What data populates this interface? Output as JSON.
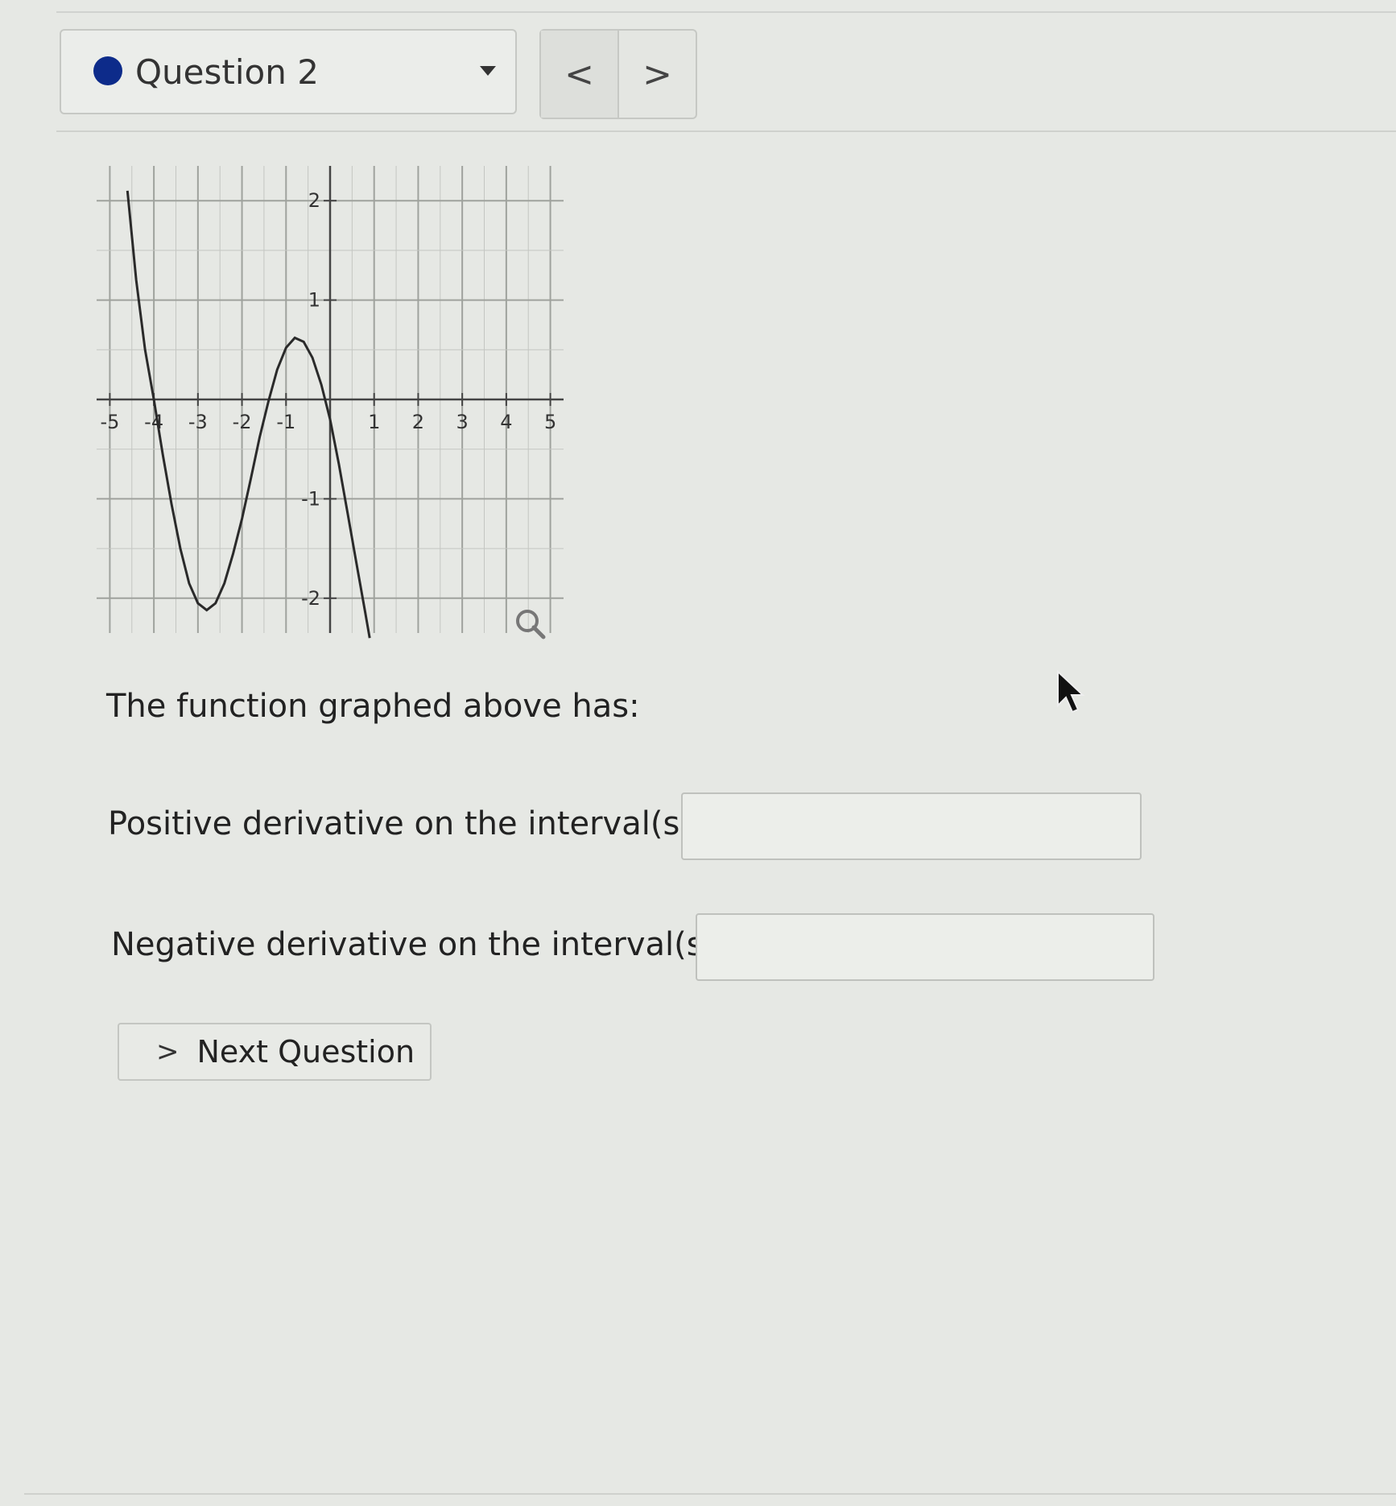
{
  "header": {
    "question_label": "Question 2",
    "status_color": "#0d2b8a",
    "prev_glyph": "<",
    "next_glyph": ">"
  },
  "graph": {
    "x_ticks": [
      "-5",
      "-4",
      "-3",
      "-2",
      "-1",
      "1",
      "2",
      "3",
      "4",
      "5"
    ],
    "y_ticks": [
      "2",
      "1",
      "-1",
      "-2"
    ],
    "zoom_icon": "magnifier-icon"
  },
  "chart_data": {
    "type": "line",
    "xlim": [
      -5.3,
      5.3
    ],
    "ylim": [
      -2.35,
      2.35
    ],
    "grid": true,
    "series": [
      {
        "x": [
          -4.6,
          -4.4,
          -4.2,
          -4.0,
          -3.8,
          -3.6,
          -3.4,
          -3.2,
          -3.0,
          -2.8,
          -2.6,
          -2.4,
          -2.2,
          -2.0,
          -1.8,
          -1.6,
          -1.4,
          -1.2,
          -1.0,
          -0.8,
          -0.6,
          -0.4,
          -0.2,
          0.0,
          0.2,
          0.4,
          0.6,
          0.8,
          0.9
        ],
        "y": [
          2.1,
          1.2,
          0.5,
          0.0,
          -0.55,
          -1.05,
          -1.5,
          -1.85,
          -2.05,
          -2.12,
          -2.05,
          -1.85,
          -1.55,
          -1.2,
          -0.8,
          -0.38,
          -0.02,
          0.3,
          0.52,
          0.62,
          0.58,
          0.42,
          0.15,
          -0.2,
          -0.65,
          -1.15,
          -1.65,
          -2.15,
          -2.4
        ]
      }
    ]
  },
  "prompt": "The function graphed above has:",
  "positive": {
    "label": "Positive derivative on the interval(s)",
    "value": ""
  },
  "negative": {
    "label": "Negative derivative on the interval(s)",
    "value": ""
  },
  "next_button": {
    "glyph": ">",
    "label": "Next Question"
  }
}
